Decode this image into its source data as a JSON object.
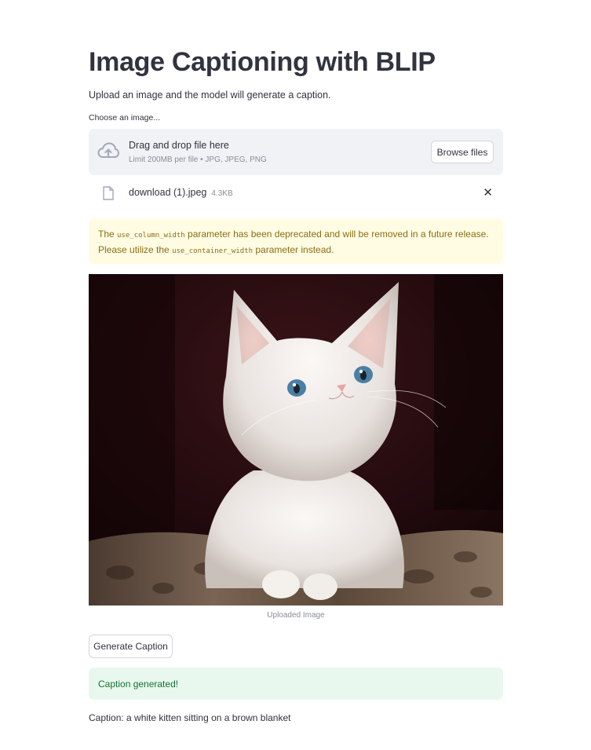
{
  "page": {
    "title": "Image Captioning with BLIP",
    "subtitle": "Upload an image and the model will generate a caption."
  },
  "uploader": {
    "label": "Choose an image...",
    "drop_text": "Drag and drop file here",
    "limit_text": "Limit 200MB per file • JPG, JPEG, PNG",
    "browse_label": "Browse files",
    "icon": "cloud-upload-icon"
  },
  "uploaded_file": {
    "name": "download (1).jpeg",
    "size": "4.3KB",
    "icon": "file-icon",
    "remove_glyph": "✕"
  },
  "warning": {
    "prefix": "The ",
    "code1": "use_column_width",
    "middle": " parameter has been deprecated and will be removed in a future release. Please utilize the ",
    "code2": "use_container_width",
    "suffix": " parameter instead."
  },
  "image": {
    "caption": "Uploaded Image"
  },
  "actions": {
    "generate_label": "Generate Caption"
  },
  "status": {
    "success_text": "Caption generated!"
  },
  "result": {
    "text": "Caption: a white kitten sitting on a brown blanket"
  },
  "colors": {
    "text": "#31333f",
    "muted": "#8a8d96",
    "dropzone_bg": "#f0f2f6",
    "warning_bg": "#fffce3",
    "warning_text": "#8a6d13",
    "success_bg": "#e8f8ee",
    "success_text": "#177233"
  }
}
